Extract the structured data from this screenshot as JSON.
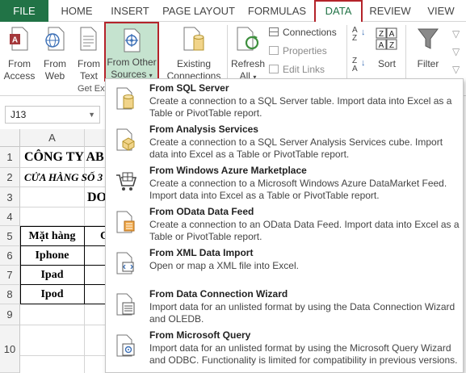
{
  "tabs": [
    {
      "label": "FILE"
    },
    {
      "label": "HOME"
    },
    {
      "label": "INSERT"
    },
    {
      "label": "PAGE LAYOUT"
    },
    {
      "label": "FORMULAS"
    },
    {
      "label": "DATA"
    },
    {
      "label": "REVIEW"
    },
    {
      "label": "VIEW"
    }
  ],
  "ribbon": {
    "from_access": [
      "From",
      "Access"
    ],
    "from_web": [
      "From",
      "Web"
    ],
    "from_text": [
      "From",
      "Text"
    ],
    "from_other": [
      "From Other",
      "Sources"
    ],
    "group_label": "Get Ext",
    "existing": [
      "Existing",
      "Connections"
    ],
    "refresh": [
      "Refresh",
      "All"
    ],
    "connections": "Connections",
    "properties": "Properties",
    "edit_links": "Edit Links",
    "sort": "Sort",
    "filter": "Filter",
    "sort_az_top": "A",
    "sort_az_bottom": "Z",
    "sort_za_top": "Z",
    "sort_za_bottom": "A"
  },
  "namebox": {
    "value": "J13"
  },
  "columns": [
    "A"
  ],
  "rows": [
    "1",
    "2",
    "3",
    "4",
    "5",
    "6",
    "7",
    "8",
    "9",
    "10"
  ],
  "cells": {
    "a1": "CÔNG TY AB",
    "a2": "CỬA HÀNG SỐ 3",
    "a3": "DO",
    "a5": "Mặt hàng",
    "b5": "C",
    "a6": "Iphone",
    "a7": "Ipad",
    "a8": "Ipod"
  },
  "menu": [
    {
      "title": "From SQL Server",
      "desc": "Create a connection to a SQL Server table. Import data into Excel as a Table or PivotTable report.",
      "icon": "sql-server-icon"
    },
    {
      "title": "From Analysis Services",
      "desc": "Create a connection to a SQL Server Analysis Services cube. Import data into Excel as a Table or PivotTable report.",
      "icon": "analysis-services-icon"
    },
    {
      "title": "From Windows Azure Marketplace",
      "desc": "Create a connection to a Microsoft Windows Azure DataMarket Feed. Import data into Excel as a Table or PivotTable report.",
      "icon": "azure-marketplace-icon"
    },
    {
      "title": "From OData Data Feed",
      "desc": "Create a connection to an OData Data Feed. Import data into Excel as a Table or PivotTable report.",
      "icon": "odata-feed-icon"
    },
    {
      "title": "From XML Data Import",
      "desc": "Open or map a XML file into Excel.",
      "icon": "xml-import-icon"
    },
    {
      "title": "From Data Connection Wizard",
      "desc": "Import data for an unlisted format by using the Data Connection Wizard and OLEDB.",
      "icon": "connection-wizard-icon"
    },
    {
      "title": "From Microsoft Query",
      "desc": "Import data for an unlisted format by using the Microsoft Query Wizard and ODBC. Functionality is limited for compatibility in previous versions.",
      "icon": "microsoft-query-icon"
    }
  ],
  "colors": {
    "excel_green": "#217346",
    "highlight_border": "#b4232a",
    "selected_fill": "#c5e3cf"
  }
}
